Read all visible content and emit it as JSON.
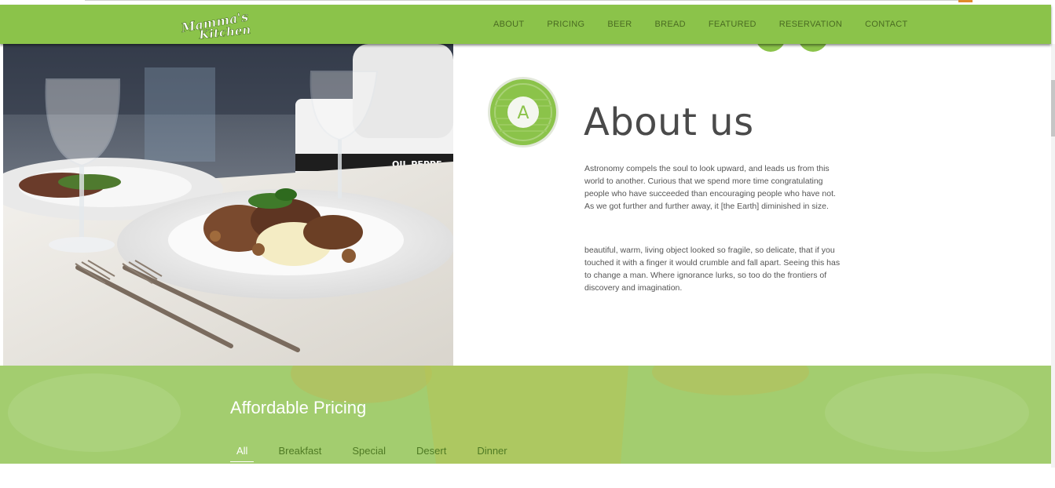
{
  "brand": {
    "logo_text": "Mamma's Kitchen"
  },
  "nav": {
    "items": [
      "ABOUT",
      "PRICING",
      "BEER",
      "BREAD",
      "FEATURED",
      "RESERVATION",
      "CONTACT"
    ]
  },
  "about": {
    "badge_letter": "A",
    "title": "About us",
    "paragraph1": "Astronomy compels the soul to look upward, and leads us from this world to another. Curious that we spend more time congratulating people who have succeeded than encouraging people who have not. As we got further and further away, it [the Earth] diminished in size.",
    "paragraph2": "beautiful, warm, living object looked so fragile, so delicate, that if you touched it with a finger it would crumble and fall apart. Seeing this has to change a man. Where ignorance lurks, so too do the frontiers of discovery and imagination."
  },
  "pricing": {
    "title": "Affordable Pricing",
    "tabs": [
      "All",
      "Breakfast",
      "Special",
      "Desert",
      "Dinner"
    ],
    "active_tab": "All"
  },
  "colors": {
    "brand_green": "#8bc34a",
    "pricing_band": "#a3cd6f",
    "nav_text": "#4a6b22"
  },
  "icons": [
    "about-badge-icon",
    "logo"
  ]
}
